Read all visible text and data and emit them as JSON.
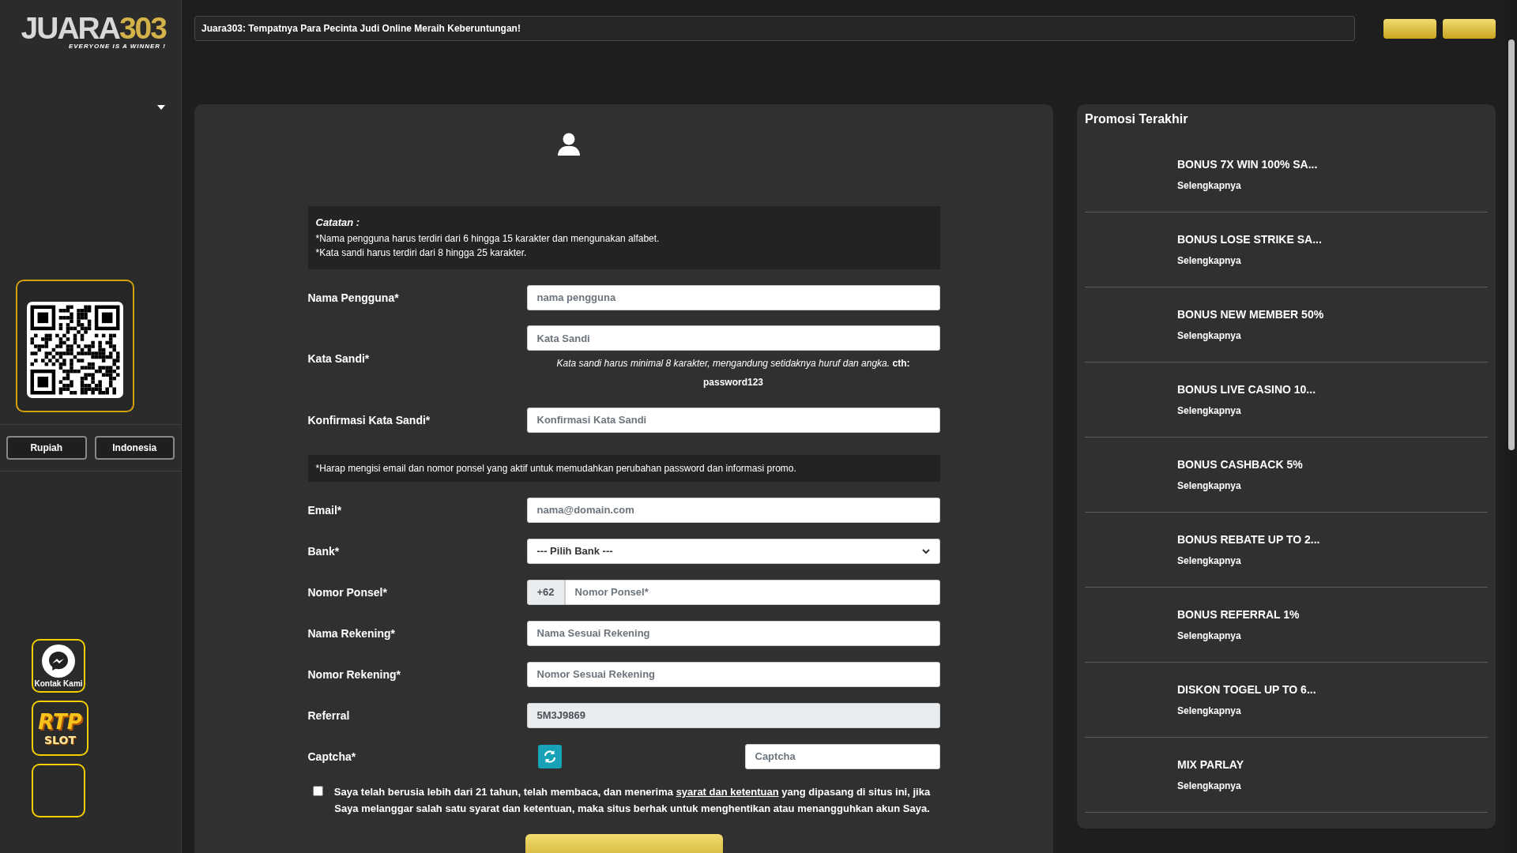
{
  "sidebar": {
    "logo": {
      "name": "JUARA",
      "number": "303",
      "tagline": "EVERYONE IS A WINNER !"
    },
    "currency_button": "Rupiah",
    "language_button": "Indonesia",
    "floating": [
      {
        "kind": "contact",
        "label": "Kontak Kami"
      },
      {
        "kind": "rtp",
        "line1": "RTP",
        "line2": "SLOT"
      },
      {
        "kind": "empty"
      }
    ]
  },
  "marquee": "Juara303: Tempatnya Para Pecinta Judi Online Meraih Keberuntungan!",
  "form": {
    "note": {
      "title": "Catatan :",
      "lines": [
        "*Nama pengguna harus terdiri dari 6 hingga 15 karakter dan mengunakan alfabet.",
        "*Kata sandi harus terdiri dari 8 hingga 25 karakter."
      ]
    },
    "fields_top": [
      {
        "kind": "text",
        "label": "Nama Pengguna*",
        "placeholder": "nama pengguna"
      },
      {
        "kind": "password",
        "label": "Kata Sandi*",
        "placeholder": "Kata Sandi",
        "hint": "*Kata sandi harus minimal 8 karakter, mengandung setidaknya huruf dan angka.* **cth: password123**"
      },
      {
        "kind": "password",
        "label": "Konfirmasi Kata Sandi*",
        "placeholder": "Konfirmasi Kata Sandi"
      }
    ],
    "info": "*Harap mengisi email dan nomor ponsel yang aktif untuk memudahkan perubahan password dan informasi promo.",
    "fields_bottom": [
      {
        "kind": "text",
        "label": "Email*",
        "placeholder": "nama@domain.com"
      },
      {
        "kind": "select",
        "label": "Bank*",
        "value": "--- Pilih Bank ---"
      },
      {
        "kind": "phone",
        "label": "Nomor Ponsel*",
        "prefix": "+62",
        "placeholder": "Nomor Ponsel*"
      },
      {
        "kind": "text",
        "label": "Nama Rekening*",
        "placeholder": "Nama Sesuai Rekening"
      },
      {
        "kind": "text",
        "label": "Nomor Rekening*",
        "placeholder": "Nomor Sesuai Rekening"
      },
      {
        "kind": "readonly",
        "label": "Referral",
        "value": "5M3J9869"
      },
      {
        "kind": "captcha",
        "label": "Captcha*",
        "placeholder": "Captcha"
      }
    ],
    "agreement": {
      "checked": false,
      "before": "Saya telah berusia lebih dari 21 tahun, telah membaca, dan menerima ",
      "link": "syarat dan ketentuan",
      "after": " yang dipasang di situs ini, jika Saya melanggar salah satu syarat dan ketentuan, maka situs berhak untuk menghentikan atau menangguhkan akun Saya."
    }
  },
  "promotions": {
    "title": "Promosi Terakhir",
    "items": [
      {
        "title": "BONUS 7X WIN 100% SA...",
        "link": "Selengkapnya"
      },
      {
        "title": "BONUS LOSE STRIKE SA...",
        "link": "Selengkapnya"
      },
      {
        "title": "BONUS NEW MEMBER 50%",
        "link": "Selengkapnya"
      },
      {
        "title": "BONUS LIVE CASINO 10...",
        "link": "Selengkapnya"
      },
      {
        "title": "BONUS CASHBACK 5%",
        "link": "Selengkapnya"
      },
      {
        "title": "BONUS REBATE UP TO 2...",
        "link": "Selengkapnya"
      },
      {
        "title": "BONUS REFERRAL 1%",
        "link": "Selengkapnya"
      },
      {
        "title": "DISKON TOGEL UP TO 6...",
        "link": "Selengkapnya"
      },
      {
        "title": "MIX PARLAY",
        "link": "Selengkapnya"
      }
    ]
  }
}
